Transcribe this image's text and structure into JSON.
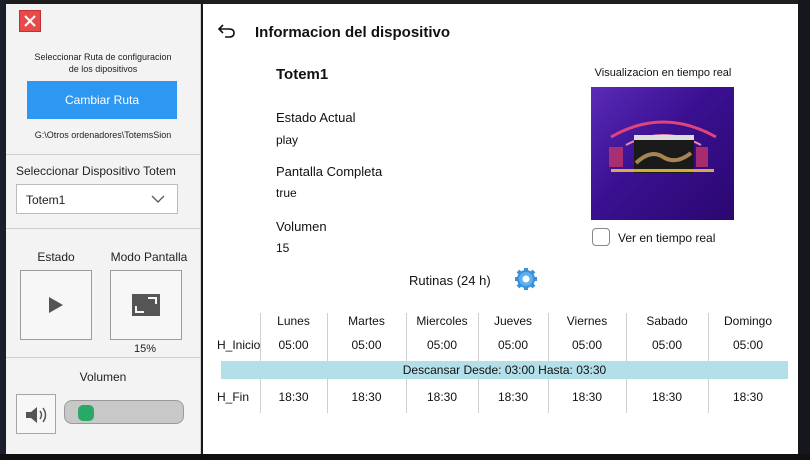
{
  "left_panel": {
    "close_icon": "close-x-icon",
    "ruta_title_line1": "Seleccionar Ruta de configuracion",
    "ruta_title_line2": "de los dipositivos",
    "cambiar_ruta_label": "Cambiar Ruta",
    "ruta_path": "G:\\Otros ordenadores\\TotemsSion",
    "select_device_label": "Seleccionar Dispositivo Totem",
    "selected_device": "Totem1",
    "estado_label": "Estado",
    "modo_label": "Modo Pantalla",
    "modo_percent": "15%",
    "volumen_label": "Volumen",
    "volume_level": 0.1,
    "accent_color": "#2e97f2",
    "slider_thumb_color": "#2aa868"
  },
  "main": {
    "title": "Informacion del dispositivo",
    "device_name": "Totem1",
    "estado_label": "Estado Actual",
    "estado_value": "play",
    "pantalla_label": "Pantalla Completa",
    "pantalla_value": "true",
    "volumen_label": "Volumen",
    "volumen_value": "15",
    "viz_title": "Visualizacion en tiempo real",
    "ver_tiempo_label": "Ver en tiempo real",
    "rutinas_label": "Rutinas (24 h)"
  },
  "schedule": {
    "days": [
      "Lunes",
      "Martes",
      "Miercoles",
      "Jueves",
      "Viernes",
      "Sabado",
      "Domingo"
    ],
    "inicio_label": "H_Inicio",
    "fin_label": "H_Fin",
    "inicio": [
      "05:00",
      "05:00",
      "05:00",
      "05:00",
      "05:00",
      "05:00",
      "05:00"
    ],
    "fin": [
      "18:30",
      "18:30",
      "18:30",
      "18:30",
      "18:30",
      "18:30",
      "18:30"
    ],
    "descanso": "Descansar Desde: 03:00 Hasta: 03:30",
    "descanso_color": "#b3e0e8"
  }
}
